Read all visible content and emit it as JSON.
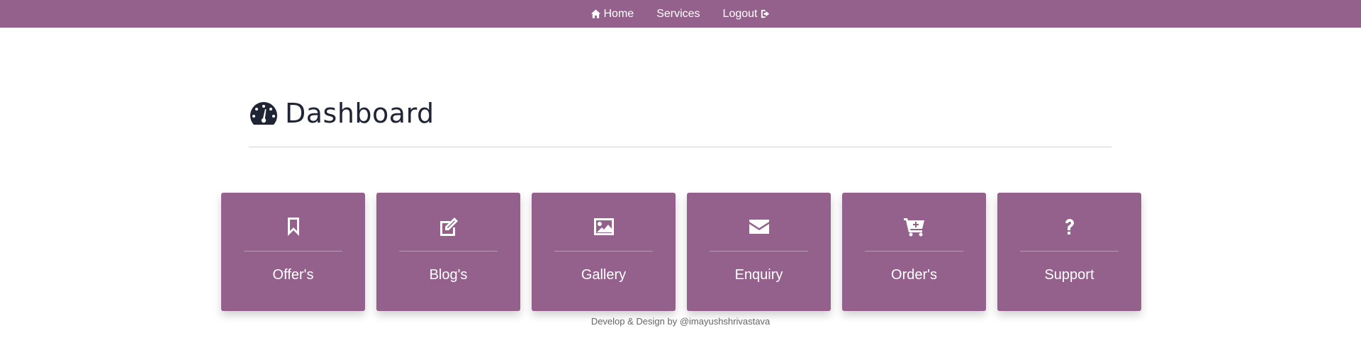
{
  "nav": {
    "home_label": "Home",
    "services_label": "Services",
    "logout_label": "Logout"
  },
  "header": {
    "title": "Dashboard",
    "icon": "dashboard-gauge-icon"
  },
  "tiles": [
    {
      "label": "Offer's",
      "icon": "bookmark-icon"
    },
    {
      "label": "Blog's",
      "icon": "edit-icon"
    },
    {
      "label": "Gallery",
      "icon": "image-icon"
    },
    {
      "label": "Enquiry",
      "icon": "envelope-icon"
    },
    {
      "label": "Order's",
      "icon": "cart-plus-icon"
    },
    {
      "label": "Support",
      "icon": "question-icon"
    }
  ],
  "footer": {
    "text": "Develop & Design by @imayushshrivastava"
  },
  "colors": {
    "brand": "#93618c",
    "title": "#1f2535"
  }
}
